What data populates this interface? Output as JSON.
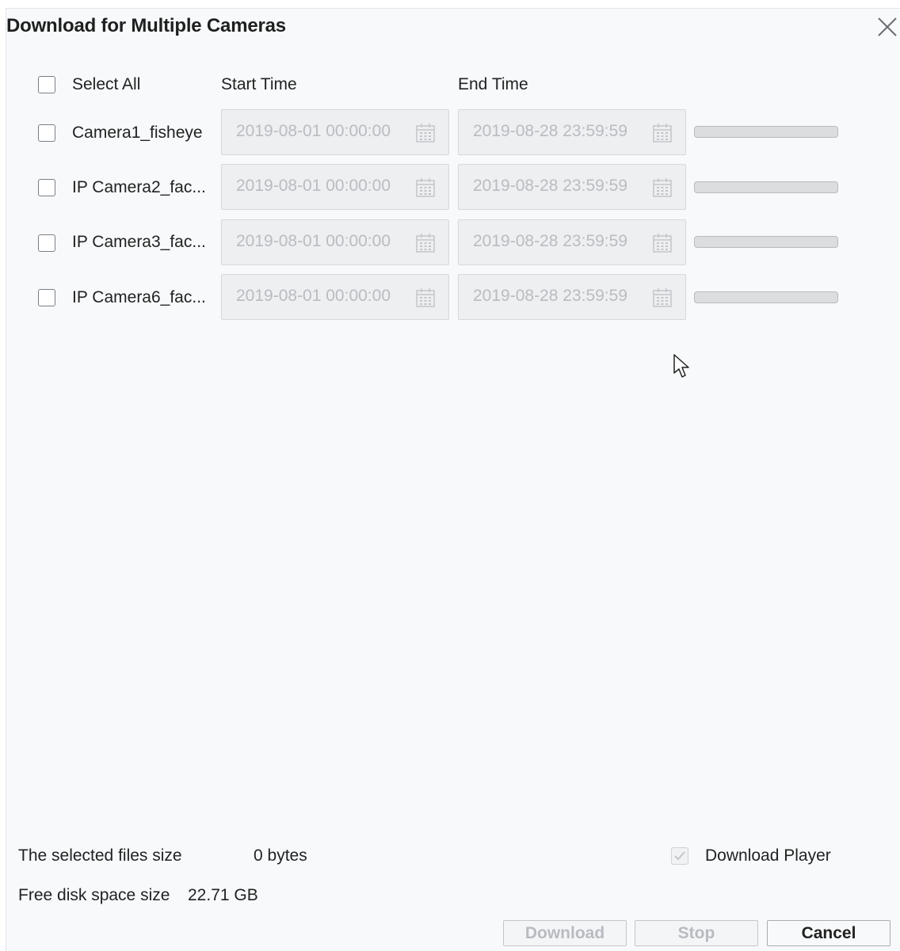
{
  "dialog": {
    "title": "Download for Multiple Cameras",
    "close_icon": "close-icon"
  },
  "header": {
    "select_all_label": "Select All",
    "select_all_checked": false,
    "start_time_label": "Start Time",
    "end_time_label": "End Time"
  },
  "cameras": [
    {
      "name": "Camera1_fisheye",
      "checked": false,
      "start": "2019-08-01 00:00:00",
      "end": "2019-08-28 23:59:59",
      "progress": 0
    },
    {
      "name": "IP Camera2_fac...",
      "checked": false,
      "start": "2019-08-01 00:00:00",
      "end": "2019-08-28 23:59:59",
      "progress": 0
    },
    {
      "name": "IP Camera3_fac...",
      "checked": false,
      "start": "2019-08-01 00:00:00",
      "end": "2019-08-28 23:59:59",
      "progress": 0
    },
    {
      "name": "IP Camera6_fac...",
      "checked": false,
      "start": "2019-08-01 00:00:00",
      "end": "2019-08-28 23:59:59",
      "progress": 0
    }
  ],
  "footer": {
    "selected_size_label": "The selected files size",
    "selected_size_value": "0 bytes",
    "free_space_label": "Free disk space size",
    "free_space_value": "22.71 GB",
    "download_player_label": "Download Player",
    "download_player_checked": true
  },
  "buttons": {
    "download": "Download",
    "stop": "Stop",
    "cancel": "Cancel"
  },
  "icons": {
    "calendar": "calendar-icon",
    "cursor": "mouse-pointer-icon"
  },
  "colors": {
    "background": "#f7f9fb",
    "disabled_text": "#b9bcc1",
    "field_bg": "#eeeff1"
  }
}
